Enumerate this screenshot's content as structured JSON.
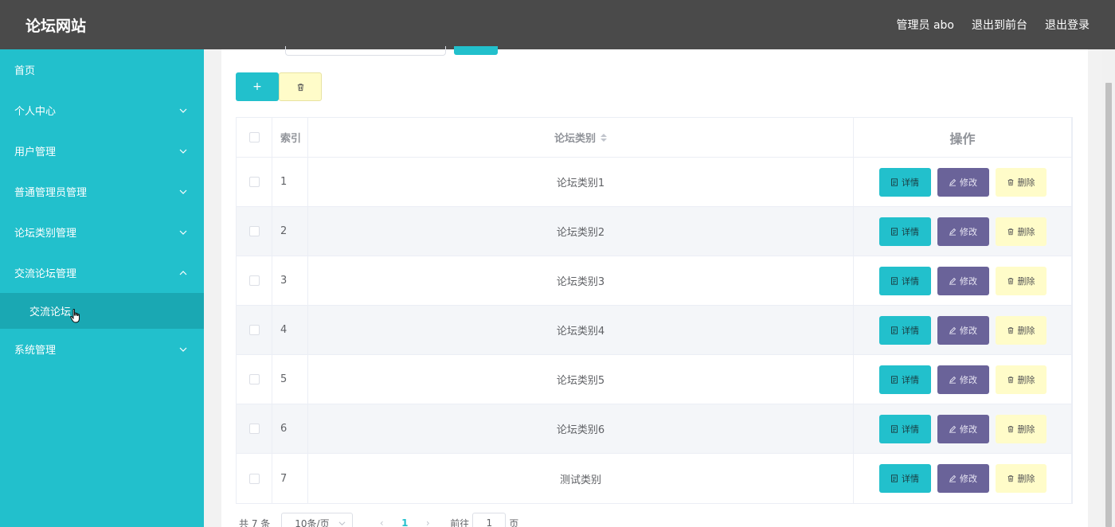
{
  "header": {
    "title": "论坛网站",
    "admin_label": "管理员 abo",
    "back_to_front": "退出到前台",
    "logout": "退出登录"
  },
  "sidebar": {
    "items": [
      {
        "label": "首页",
        "has_arrow": false
      },
      {
        "label": "个人中心",
        "has_arrow": true
      },
      {
        "label": "用户管理",
        "has_arrow": true
      },
      {
        "label": "普通管理员管理",
        "has_arrow": true
      },
      {
        "label": "论坛类别管理",
        "has_arrow": true
      },
      {
        "label": "交流论坛管理",
        "has_arrow": true,
        "expanded": true
      }
    ],
    "submenu": {
      "label": "交流论坛"
    },
    "after_items": [
      {
        "label": "系统管理",
        "has_arrow": true
      }
    ]
  },
  "table": {
    "headers": {
      "index": "索引",
      "category": "论坛类别",
      "ops": "操作"
    },
    "rows": [
      {
        "index": "1",
        "category": "论坛类别1"
      },
      {
        "index": "2",
        "category": "论坛类别2"
      },
      {
        "index": "3",
        "category": "论坛类别3"
      },
      {
        "index": "4",
        "category": "论坛类别4"
      },
      {
        "index": "5",
        "category": "论坛类别5"
      },
      {
        "index": "6",
        "category": "论坛类别6"
      },
      {
        "index": "7",
        "category": "测试类别"
      }
    ],
    "op_labels": {
      "detail": "详情",
      "edit": "修改",
      "delete": "删除"
    }
  },
  "toolbar": {
    "add_label": "+"
  },
  "pagination": {
    "total": "共 7 条",
    "page_size": "10条/页",
    "current_page": "1",
    "goto_prefix": "前往",
    "goto_value": "1",
    "goto_suffix": "页"
  },
  "colors": {
    "accent": "#22c0cc",
    "edit": "#6a6399",
    "delete": "#fffcc9",
    "topbar": "#4a4a4a"
  }
}
